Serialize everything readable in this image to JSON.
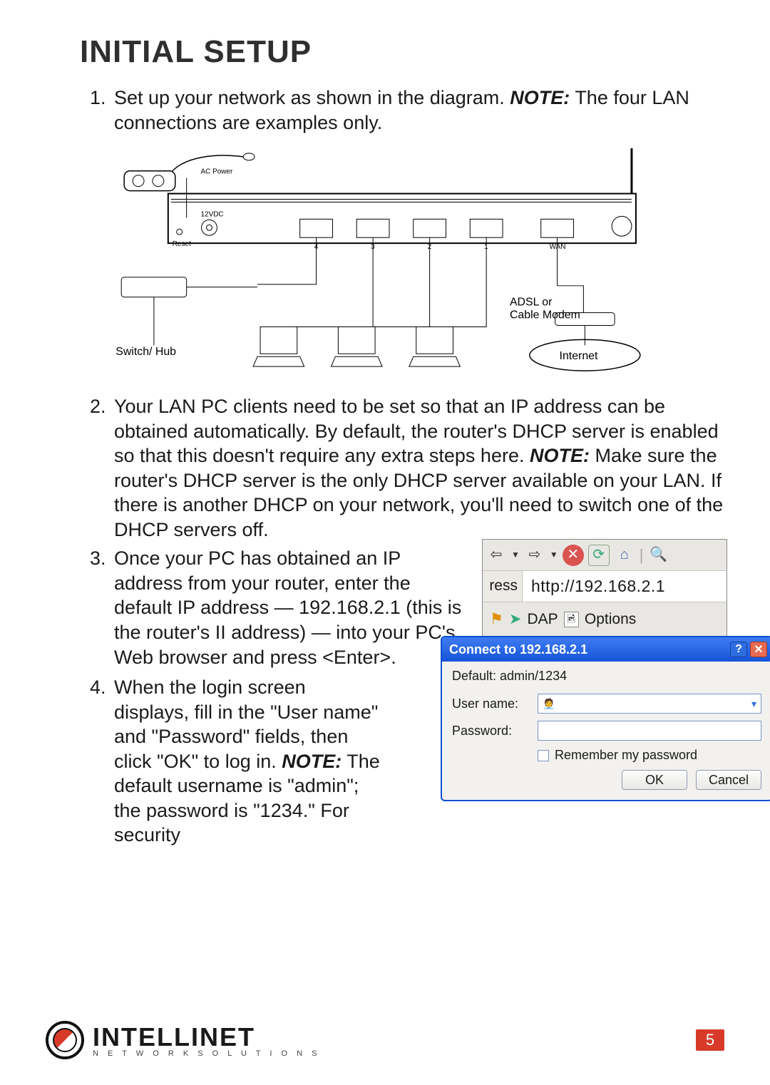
{
  "heading": "INITIAL SETUP",
  "steps": {
    "s1_a": "Set up your network as shown in the diagram. ",
    "s1_note": "NOTE:",
    "s1_b": " The four LAN connections are examples only.",
    "s2_a": "Your LAN PC clients need to be set so that an IP address can be obtained automatically. By default, the router's DHCP server is enabled so that this doesn't require any extra steps here. ",
    "s2_note": "NOTE:",
    "s2_b": " Make sure the router's DHCP server is the only DHCP server available on your LAN. If there is another DHCP on your network, you'll need to switch one of the DHCP servers off.",
    "s3": "Once your PC has obtained an IP address from your router, enter the default IP address — 192.168.2.1 (this is the router's II address) — into your PC's Web browser and press <Enter>.",
    "s4_a": "When the login screen displays, fill in the \"User name\" and \"Password\" fields, then click \"OK\" to log in. ",
    "s4_note": "NOTE:",
    "s4_b": " The default username is \"admin\"; the password is \"1234.\" For security"
  },
  "diagram": {
    "ac_power": "AC Power",
    "twelve_vdc": "12VDC",
    "reset": "Reset",
    "ports": [
      "4",
      "3",
      "2",
      "1",
      "WAN"
    ],
    "switch_hub": "Switch/ Hub",
    "modem": "ADSL or\nCable Modem",
    "internet": "Internet"
  },
  "toolbar": {
    "address_label_fragment": "ress",
    "url": "http://192.168.2.1",
    "dap": "DAP",
    "options": "Options"
  },
  "dialog": {
    "title": "Connect to 192.168.2.1",
    "hint": "Default: admin/1234",
    "user_label": "User name:",
    "pass_label": "Password:",
    "remember": "Remember my password",
    "ok": "OK",
    "cancel": "Cancel"
  },
  "footer": {
    "brand": "INTELLINET",
    "tagline": "N E T W O R K   S O L U T I O N S",
    "page": "5"
  }
}
